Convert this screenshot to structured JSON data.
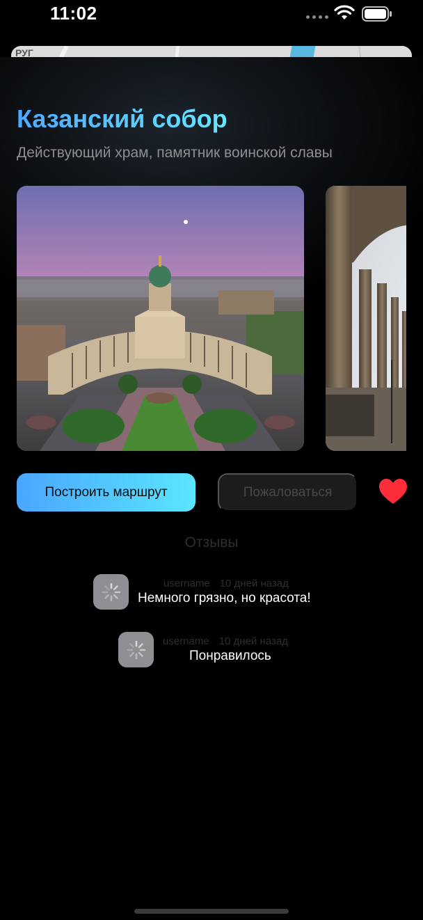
{
  "status_bar": {
    "time": "11:02"
  },
  "map": {
    "visible_label": "РУГ"
  },
  "place": {
    "title": "Казанский собор",
    "subtitle": "Действующий храм, памятник воинской славы"
  },
  "gallery": {
    "images": [
      {
        "icon": "kazan-cathedral-aerial-photo"
      },
      {
        "icon": "kazan-cathedral-colonnade-photo"
      }
    ]
  },
  "actions": {
    "route_label": "Построить маршрут",
    "report_label": "Пожаловаться",
    "favorite_icon": "heart-icon",
    "favorite_color": "#ff2d3a"
  },
  "reviews": {
    "title": "Отзывы",
    "items": [
      {
        "username": "username",
        "time": "10 дней назад",
        "text": "Немного грязно, но красота!"
      },
      {
        "username": "username",
        "time": "10 дней назад",
        "text": "Понравилось"
      }
    ]
  },
  "colors": {
    "accent_start": "#4aa6ff",
    "accent_end": "#5ae6ff"
  }
}
